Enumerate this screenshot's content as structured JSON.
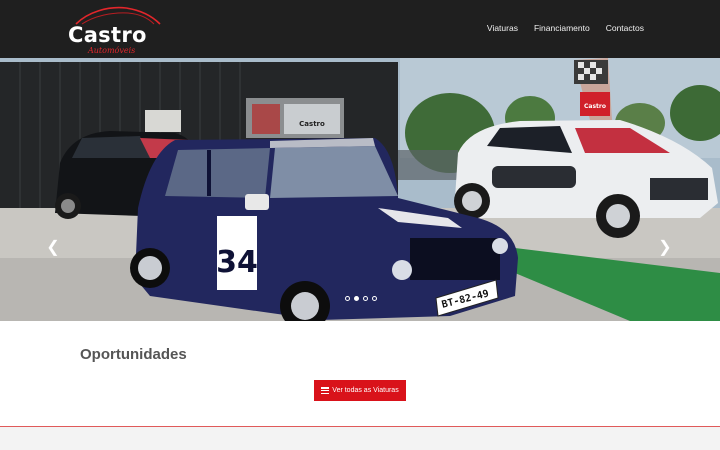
{
  "brand": {
    "name": "Castro",
    "tagline": "Automóveis"
  },
  "nav": {
    "items": [
      {
        "label": "Viaturas"
      },
      {
        "label": "Financiamento"
      },
      {
        "label": "Contactos"
      }
    ]
  },
  "hero": {
    "car_number": "34",
    "plate": "BT-82-49",
    "flag_text": "Castro",
    "building_sign": "Castro",
    "prev_icon": "chevron-left-icon",
    "next_icon": "chevron-right-icon",
    "slides": [
      {
        "active": false
      },
      {
        "active": true
      },
      {
        "active": false
      },
      {
        "active": false
      }
    ]
  },
  "main": {
    "section_title": "Oportunidades",
    "cta_label": "Ver todas as Viaturas",
    "cta_icon": "list-icon"
  },
  "colors": {
    "header_bg": "#1f1f1f",
    "accent": "#d9121a"
  }
}
